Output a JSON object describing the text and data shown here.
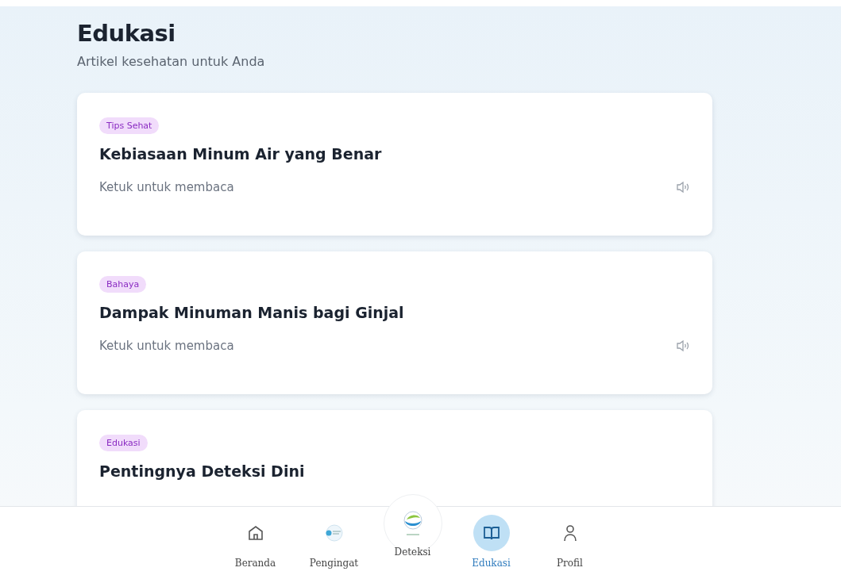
{
  "header": {
    "title": "Edukasi",
    "subtitle": "Artikel kesehatan untuk Anda"
  },
  "articles": [
    {
      "tag": "Tips Sehat",
      "title": "Kebiasaan Minum Air yang Benar",
      "hint": "Ketuk untuk membaca"
    },
    {
      "tag": "Bahaya",
      "title": "Dampak Minuman Manis bagi Ginjal",
      "hint": "Ketuk untuk membaca"
    },
    {
      "tag": "Edukasi",
      "title": "Pentingnya Deteksi Dini"
    }
  ],
  "nav": [
    {
      "kind": "home",
      "label": "Beranda",
      "selected": false
    },
    {
      "kind": "logo",
      "label": "Pengingat",
      "selected": false
    },
    {
      "kind": "center",
      "label": "Deteksi",
      "selected": false
    },
    {
      "kind": "book",
      "label": "Edukasi",
      "selected": true
    },
    {
      "kind": "person",
      "label": "Profil",
      "selected": false
    }
  ]
}
